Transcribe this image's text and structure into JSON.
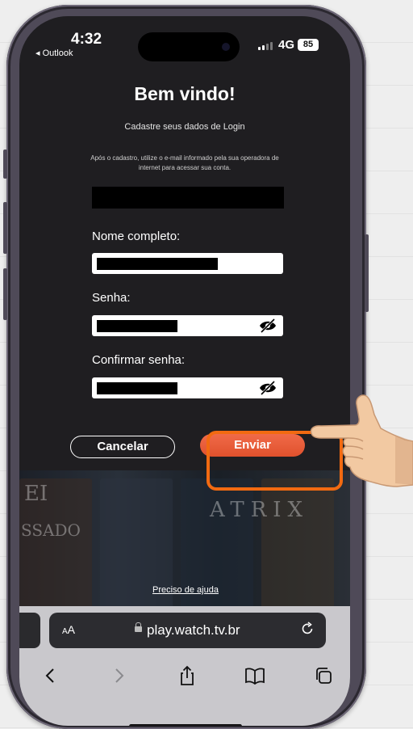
{
  "status": {
    "time": "4:32",
    "back_app": "◂ Outlook",
    "network": "4G",
    "battery": "85"
  },
  "page": {
    "title": "Bem vindo!",
    "subtitle": "Cadastre seus dados de Login",
    "info": "Após o cadastro, utilize o e-mail informado pela sua operadora de internet para acessar sua conta.",
    "fields": {
      "name_label": "Nome completo:",
      "password_label": "Senha:",
      "confirm_label": "Confirmar senha:"
    },
    "cancel_label": "Cancelar",
    "send_label": "Enviar",
    "help_link": "Preciso de ajuda"
  },
  "browser": {
    "aa": "AA",
    "url": "play.watch.tv.br"
  },
  "colors": {
    "accent": "#e85a35",
    "highlight": "#f26a11",
    "background": "#1f1e21"
  },
  "icons": [
    "eye-slash-icon",
    "lock-icon",
    "reload-icon",
    "back-chevron-icon",
    "forward-chevron-icon",
    "share-icon",
    "bookmarks-icon",
    "tabs-icon",
    "pointing-hand-icon"
  ]
}
